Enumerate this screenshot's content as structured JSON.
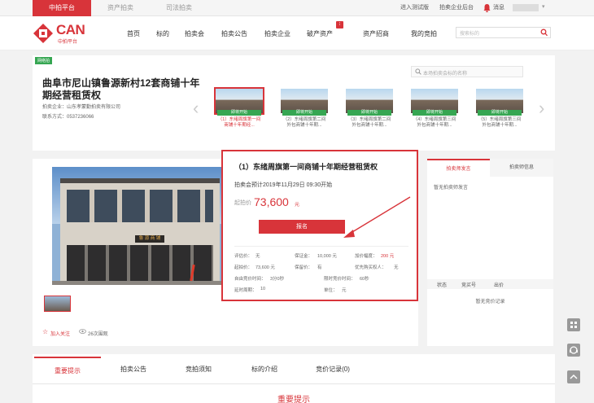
{
  "topbar": {
    "tabs": [
      "中拍平台",
      "资产拍卖",
      "司法拍卖"
    ],
    "links": [
      "进入测试版",
      "拍卖企业后台",
      "消息"
    ]
  },
  "header": {
    "logo_text": "CAN",
    "logo_sub": "中拍平台",
    "nav": [
      "首页",
      "标的",
      "拍卖会",
      "拍卖公告",
      "拍卖企业",
      "破产资产",
      "资产招商",
      "我的竞拍"
    ],
    "search_placeholder": "搜索标的"
  },
  "auction": {
    "badge": "网络拍",
    "title": "曲阜市尼山镇鲁源新村12套商铺十年期经营租赁权",
    "company": "拍卖企业：山东孝蒙勤拍卖有限公司",
    "contact": "联系方式：0537236066",
    "search_placeholder": "本场拍卖会标的名称",
    "thumbs": [
      {
        "status": "即将开始",
        "caption": "（1）东绪周旗第一间商铺十年期经..."
      },
      {
        "status": "即将开始",
        "caption": "（2）东绪周旗第二间外包商铺十年期..."
      },
      {
        "status": "即将开始",
        "caption": "（3）东绪周旗第二间外包商铺十年期..."
      },
      {
        "status": "即将开始",
        "caption": "（4）东绪周旗第三间外包商铺十年期..."
      },
      {
        "status": "即将开始",
        "caption": "（5）东绪周旗第三间外包商铺十年期..."
      }
    ]
  },
  "lot": {
    "title": "（1）东绪周旗第一间商铺十年期经营租赁权",
    "time": "拍卖会预计2019年11月29日 09:30开始",
    "price_label": "起拍价",
    "price": "73,600",
    "price_unit": "元",
    "signup": "报名",
    "fields": [
      [
        "评估价：",
        "无"
      ],
      [
        "保证金：",
        "10,000 元"
      ],
      [
        "加价幅度：",
        "200 元"
      ],
      [
        "起拍价：",
        "73,600 元"
      ],
      [
        "保留价：",
        "有"
      ],
      [
        "优先购买权人：",
        "无"
      ],
      [
        "自由竞价时间：",
        "3分0秒"
      ],
      [
        "",
        ""
      ],
      [
        "限时竞价时间：",
        "60秒"
      ],
      [
        "延时周期：",
        "10"
      ],
      [
        "",
        ""
      ],
      [
        "单位：",
        "元"
      ]
    ],
    "follow": "加入关注",
    "views": "26次围观",
    "photo_sign": "鲁 源 商 铺"
  },
  "right_panel": {
    "tabs": [
      "拍卖师发言",
      "拍卖师信息"
    ],
    "empty_speech": "暂无拍卖师发言",
    "table_headers": [
      "状态",
      "竞买号",
      "出价"
    ],
    "empty_bids": "暂无竞价记录"
  },
  "bottom_tabs": [
    "重要提示",
    "拍卖公告",
    "竞拍须知",
    "标的介绍",
    "竞价记录(0)"
  ],
  "bottom_heading": "重要提示",
  "colors": {
    "accent": "#d8343a",
    "green": "#36a652"
  }
}
